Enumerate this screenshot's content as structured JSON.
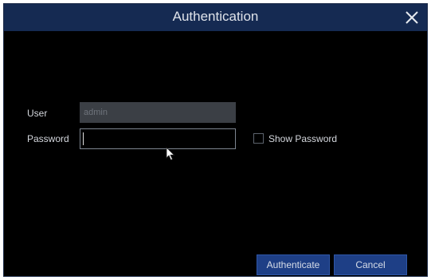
{
  "dialog": {
    "title": "Authentication",
    "close_icon": "close-icon"
  },
  "form": {
    "user_label": "User",
    "user_value": "admin",
    "password_label": "Password",
    "password_value": "",
    "show_password_label": "Show Password",
    "show_password_checked": false
  },
  "buttons": {
    "authenticate_label": "Authenticate",
    "cancel_label": "Cancel"
  },
  "colors": {
    "titlebar": "#152a52",
    "background": "#000000",
    "button": "#1e3f86"
  }
}
